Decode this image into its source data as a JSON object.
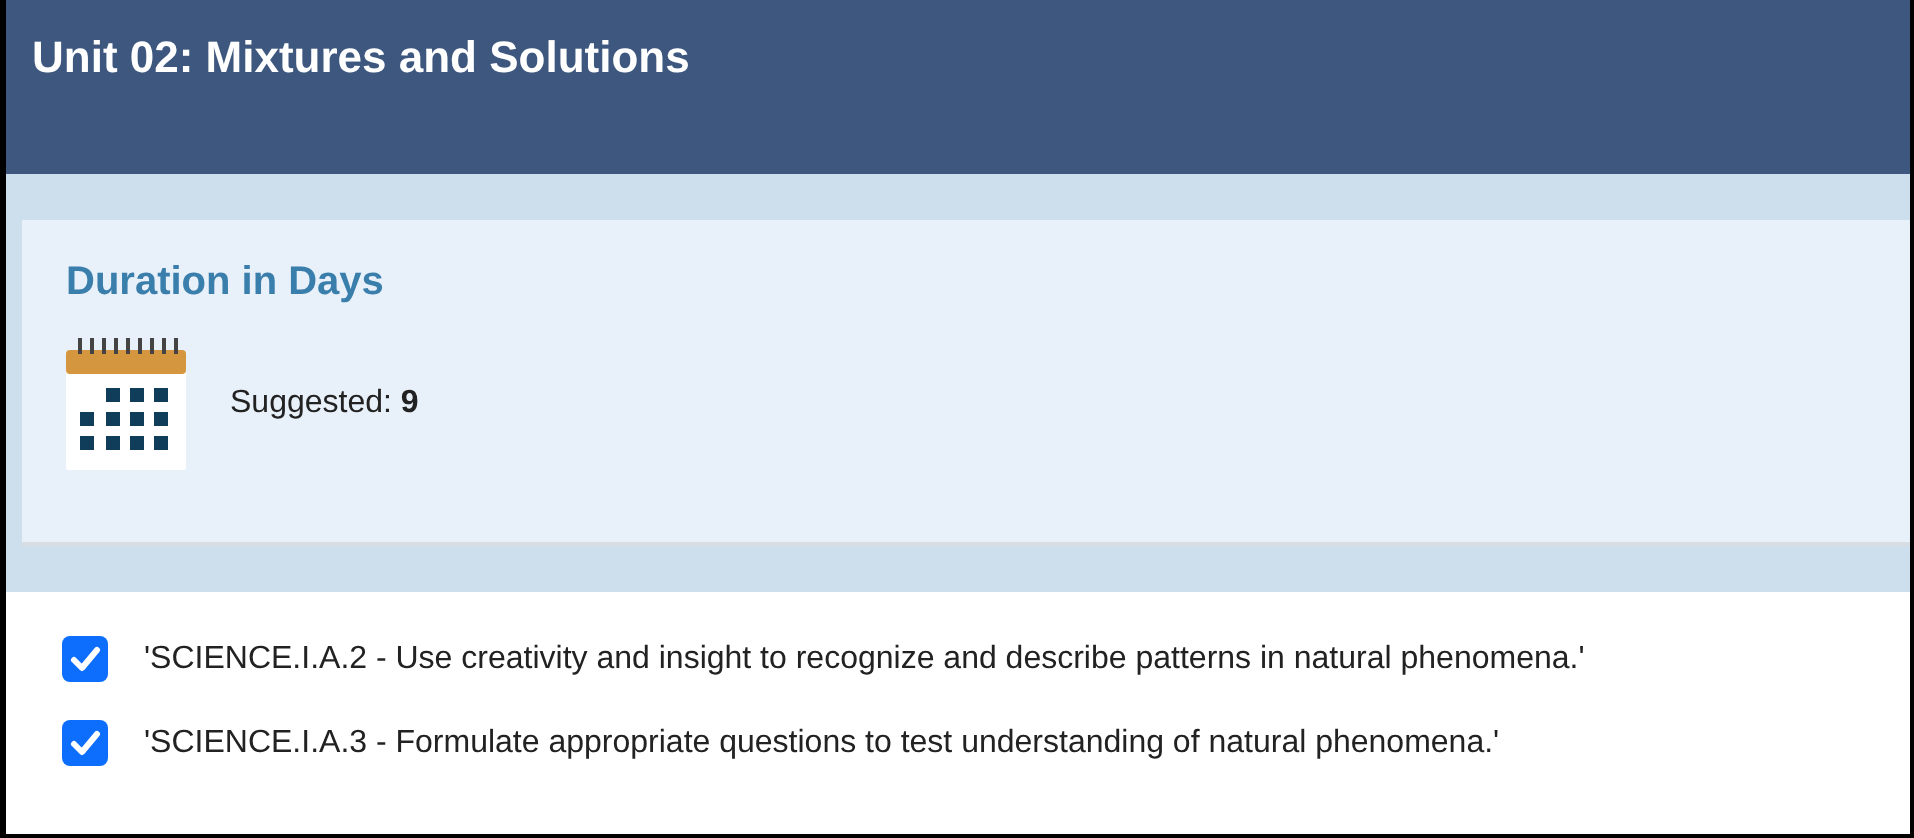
{
  "header": {
    "title": "Unit 02: Mixtures and Solutions"
  },
  "duration": {
    "heading": "Duration in Days",
    "suggested": "Suggested: **9**"
  },
  "standards": [
    {
      "label": "'SCIENCE.I.A.2 - Use creativity and insight to recognize and describe patterns in natural phenomena.'",
      "checked": true
    },
    {
      "label": "'SCIENCE.I.A.3 - Formulate appropriate questions to test understanding of natural phenomena.'",
      "checked": true
    }
  ]
}
